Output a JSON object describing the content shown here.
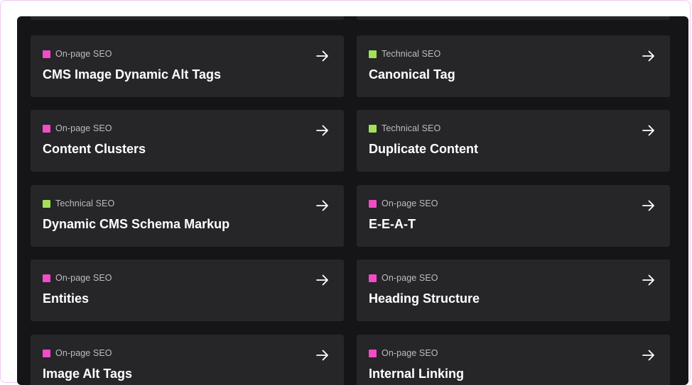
{
  "cards": [
    {
      "tag": "On-page SEO",
      "tag_type": "onpage",
      "title": "CMS Image Dynamic Alt Tags"
    },
    {
      "tag": "Technical SEO",
      "tag_type": "technical",
      "title": "Canonical Tag"
    },
    {
      "tag": "On-page SEO",
      "tag_type": "onpage",
      "title": "Content Clusters"
    },
    {
      "tag": "Technical SEO",
      "tag_type": "technical",
      "title": "Duplicate Content"
    },
    {
      "tag": "Technical SEO",
      "tag_type": "technical",
      "title": "Dynamic CMS Schema Markup"
    },
    {
      "tag": "On-page SEO",
      "tag_type": "onpage",
      "title": "E-E-A-T"
    },
    {
      "tag": "On-page SEO",
      "tag_type": "onpage",
      "title": "Entities"
    },
    {
      "tag": "On-page SEO",
      "tag_type": "onpage",
      "title": "Heading Structure"
    },
    {
      "tag": "On-page SEO",
      "tag_type": "onpage",
      "title": "Image Alt Tags"
    },
    {
      "tag": "On-page SEO",
      "tag_type": "onpage",
      "title": "Internal Linking"
    }
  ],
  "colors": {
    "onpage": "#f24cc8",
    "technical": "#a2e05a",
    "card_bg": "#262528",
    "panel_bg": "#151416"
  },
  "icons": {
    "card_action": "arrow-right-icon",
    "tag_marker": "square-icon"
  }
}
